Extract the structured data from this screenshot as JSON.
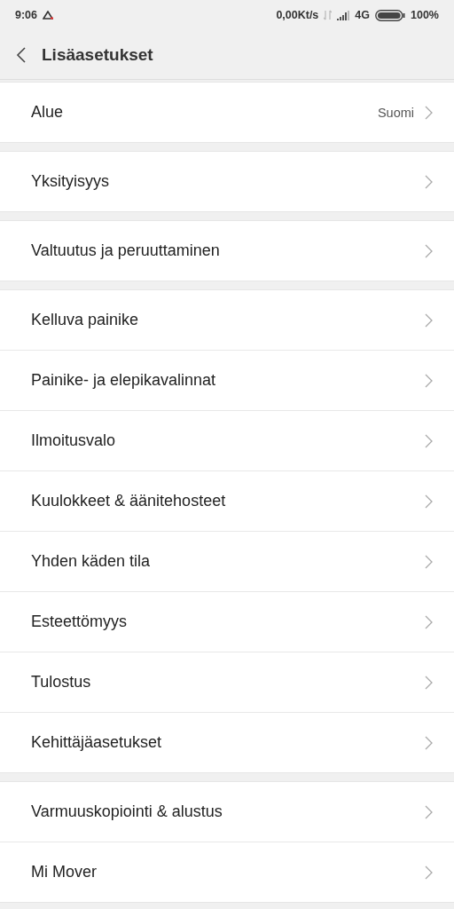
{
  "status_bar": {
    "time": "9:06",
    "speed": "0,00Kt/s",
    "network": "4G",
    "battery": "100%"
  },
  "header": {
    "title": "Lisäasetukset"
  },
  "groups": [
    {
      "items": [
        {
          "label": "Alue",
          "value": "Suomi"
        }
      ]
    },
    {
      "items": [
        {
          "label": "Yksityisyys"
        }
      ]
    },
    {
      "items": [
        {
          "label": "Valtuutus ja peruuttaminen"
        }
      ]
    },
    {
      "items": [
        {
          "label": "Kelluva painike"
        },
        {
          "label": "Painike- ja elepikavalinnat"
        },
        {
          "label": "Ilmoitusvalo"
        },
        {
          "label": "Kuulokkeet & äänitehosteet"
        },
        {
          "label": "Yhden käden tila"
        },
        {
          "label": "Esteettömyys"
        },
        {
          "label": "Tulostus"
        },
        {
          "label": "Kehittäjäasetukset"
        }
      ]
    },
    {
      "items": [
        {
          "label": "Varmuuskopiointi & alustus"
        },
        {
          "label": "Mi Mover"
        }
      ]
    }
  ]
}
